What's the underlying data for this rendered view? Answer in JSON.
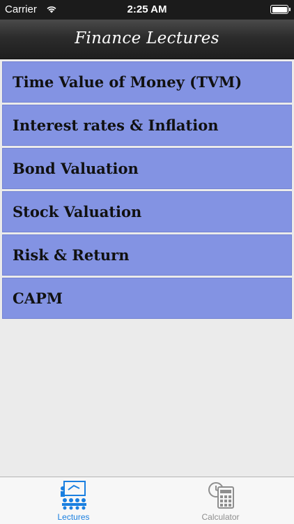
{
  "status_bar": {
    "carrier": "Carrier",
    "time": "2:25 AM"
  },
  "nav_bar": {
    "title": "Finance Lectures"
  },
  "lectures": [
    {
      "label": "Time Value of Money (TVM)"
    },
    {
      "label": "Interest rates & Inflation"
    },
    {
      "label": "Bond Valuation"
    },
    {
      "label": "Stock Valuation"
    },
    {
      "label": "Risk & Return"
    },
    {
      "label": "CAPM"
    }
  ],
  "tab_bar": {
    "tabs": [
      {
        "label": "Lectures",
        "icon": "classroom-icon",
        "selected": true
      },
      {
        "label": "Calculator",
        "icon": "calendar-calculator-icon",
        "selected": false
      }
    ]
  },
  "colors": {
    "list_item_bg": "#8393e3",
    "tab_active": "#1a7fe0",
    "tab_inactive": "#8e8e8e"
  }
}
